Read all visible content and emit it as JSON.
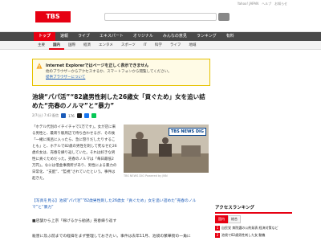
{
  "header": {
    "logo_text": "TBS",
    "top_links": "Yahoo! JAPAN　ヘルプ　お知らせ"
  },
  "nav_main": {
    "items": [
      "トップ",
      "速報",
      "ライブ",
      "エキスパート",
      "オリジナル",
      "みんなの意見",
      "ランキング",
      "有料"
    ]
  },
  "nav_sub": {
    "items": [
      "主要",
      "国内",
      "国際",
      "経済",
      "エンタメ",
      "スポーツ",
      "IT",
      "科学",
      "ライフ",
      "地域"
    ]
  },
  "notice": {
    "title": "Internet Explorerではページを正しく表示できません",
    "body": "他のブラウザーからアクセスするか、スマートフォンから閲覧してください。",
    "link": "提供ブラウザーについて"
  },
  "article": {
    "headline": "池袋“パパ活”“82歳男性刺した26歳女「貢ぐため」女を追い詰めた“売春のノルマ”と“暴力”",
    "meta_date": "2/7(土) 7:43 配信",
    "comment_count": "176",
    "body": "「ホテル代別のイチイチャで1万です」。女が店に来る男性と、最寄り駅周辺で待ち合わせるが、その後「一緒に風呂に入ったら、急に怒りだしたりすることも」と、ホテルで82歳の男性を刺して死なせた26歳の女は、売春を繰り返していた。それは好きな男性に貢ぐためだった。売春のノルマは「毎日最低2万円」。なには借金事務所があり、男性による暴力の日常化、“支配”、“監視”されていたという。事件は起きた。",
    "photo_label": "TBS NEWS DIG",
    "photo_caption": "TBS NEWS DIG Powered by JNN",
    "related_link": "【写真を見る】池袋“パパ活”“82歳男性刺した26歳女「貢ぐため」女を追い詰めた“売春のノルマ”と“暴力”",
    "para2": "■店舗から上京「稼げるから勧誘」売春繰り返す",
    "para3": "殺害に及ぶ前までの経緯をまず整理しておきたい。事件は去年11月、池袋の繁華街の一角に"
  },
  "ranking": {
    "title": "アクセスランキング",
    "tabs": [
      "国内",
      "総合"
    ],
    "items": [
      {
        "num": "1",
        "text": "自民党 衆院選の公約発表 経済対策など"
      },
      {
        "num": "2",
        "text": "池袋で82歳男性刺した女 動機"
      }
    ]
  }
}
